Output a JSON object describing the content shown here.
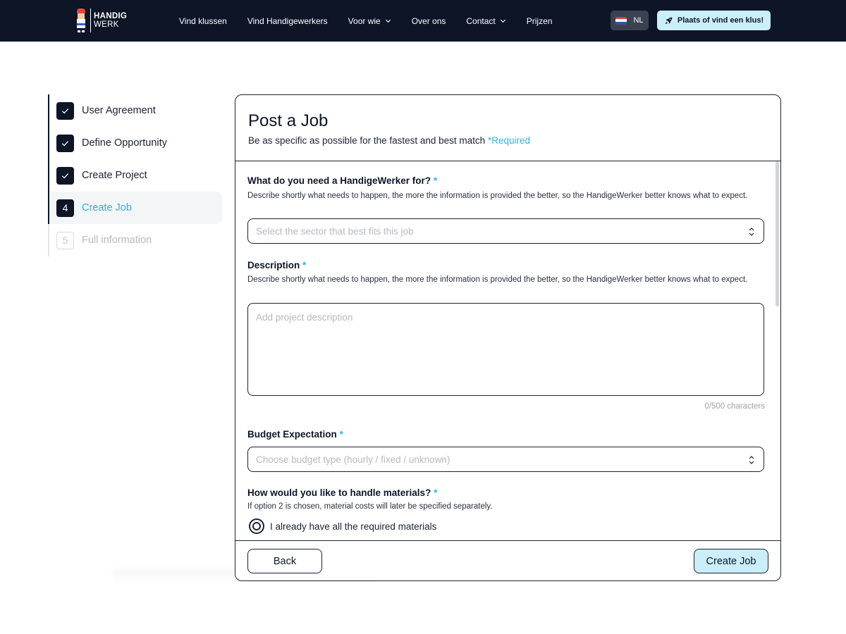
{
  "header": {
    "logo": {
      "line1": "HANDIG",
      "line2": "WERK"
    },
    "nav": [
      {
        "label": "Vind klussen",
        "dropdown": false
      },
      {
        "label": "Vind Handigewerkers",
        "dropdown": false
      },
      {
        "label": "Voor wie",
        "dropdown": true
      },
      {
        "label": "Over ons",
        "dropdown": false
      },
      {
        "label": "Contact",
        "dropdown": true
      },
      {
        "label": "Prijzen",
        "dropdown": false
      }
    ],
    "language": {
      "code": "NL",
      "icon": "netherlands-flag-icon"
    },
    "cta": {
      "label": "Plaats of vind een klus!",
      "icon": "rocket-icon"
    },
    "colors": {
      "background": "#0d1527",
      "cta": "#cbeefb"
    }
  },
  "stepper": {
    "steps": [
      {
        "label": "User Agreement",
        "state": "done",
        "marker": "check-icon"
      },
      {
        "label": "Define Opportunity",
        "state": "done",
        "marker": "check-icon"
      },
      {
        "label": "Create Project",
        "state": "done",
        "marker": "check-icon"
      },
      {
        "label": "Create Job",
        "state": "active",
        "number": "4"
      },
      {
        "label": "Full information",
        "state": "future",
        "number": "5"
      }
    ],
    "active_color": "#2fb3e0"
  },
  "form": {
    "title": "Post a Job",
    "subtitle": "Be as specific as possible for the fastest and best match",
    "required_note": "*Required",
    "sector": {
      "label": "What do you need a HandigeWerker for?",
      "required_mark": "*",
      "help": "Describe shortly what needs to happen, the more the information is provided the better, so the HandigeWerker better knows what to expect.",
      "placeholder": "Select the sector that best fits this job"
    },
    "description": {
      "label": "Description",
      "required_mark": "*",
      "help": "Describe shortly what needs to happen, the more the information is provided the better, so the HandigeWerker better knows what to expect.",
      "placeholder": "Add project description",
      "counter": "0/500 characters"
    },
    "budget": {
      "label": "Budget Expectation",
      "required_mark": "*",
      "placeholder": "Choose budget type (hourly / fixed / unknown)"
    },
    "materials": {
      "label": "How would you like to handle materials?",
      "required_mark": "*",
      "help": "If option 2 is chosen, material costs will later be specified separately.",
      "options": [
        {
          "label": "I already have all the required materials",
          "selected": true
        }
      ]
    },
    "buttons": {
      "back": "Back",
      "create": "Create Job"
    }
  }
}
